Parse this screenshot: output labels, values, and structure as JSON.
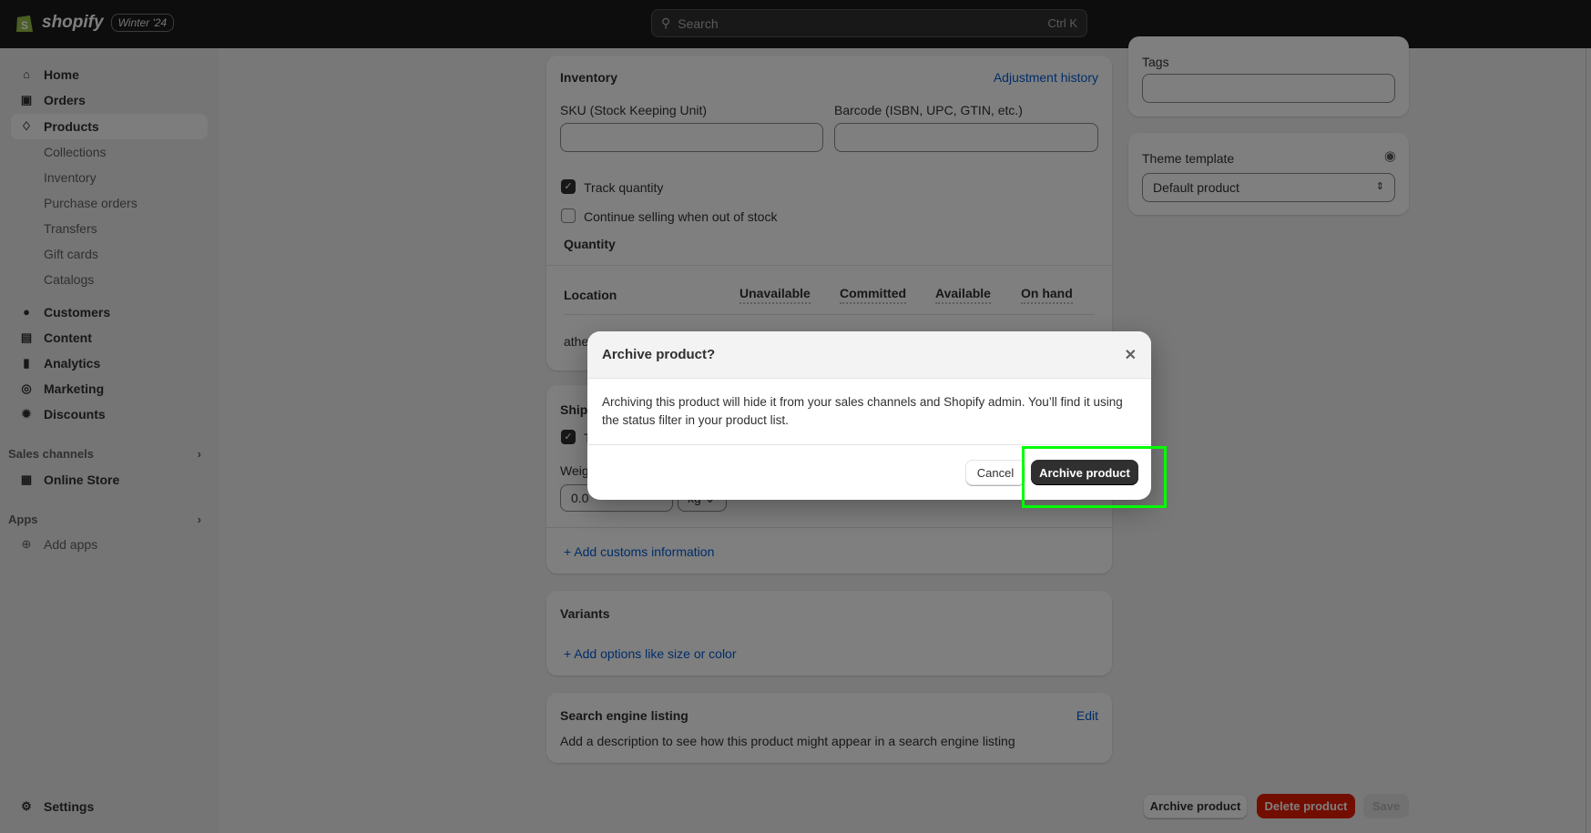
{
  "topbar": {
    "brand": "shopify",
    "badge": "Winter '24",
    "search_placeholder": "Search",
    "search_shortcut": "Ctrl K"
  },
  "sidebar": {
    "items": [
      {
        "label": "Home",
        "icon": "home-icon"
      },
      {
        "label": "Orders",
        "icon": "inbox-icon"
      },
      {
        "label": "Products",
        "icon": "tag-icon",
        "active": true
      }
    ],
    "product_sub": [
      "Collections",
      "Inventory",
      "Purchase orders",
      "Transfers",
      "Gift cards",
      "Catalogs"
    ],
    "items2": [
      {
        "label": "Customers",
        "icon": "person-icon"
      },
      {
        "label": "Content",
        "icon": "content-icon"
      },
      {
        "label": "Analytics",
        "icon": "bar-chart-icon"
      },
      {
        "label": "Marketing",
        "icon": "target-icon"
      },
      {
        "label": "Discounts",
        "icon": "discount-icon"
      }
    ],
    "sales_channels": "Sales channels",
    "online_store": "Online Store",
    "apps": "Apps",
    "add_apps": "Add apps",
    "settings": "Settings"
  },
  "inventory": {
    "title": "Inventory",
    "adjustment_history": "Adjustment history",
    "sku_label": "SKU (Stock Keeping Unit)",
    "barcode_label": "Barcode (ISBN, UPC, GTIN, etc.)",
    "sku_value": "",
    "barcode_value": "",
    "track_quantity": "Track quantity",
    "continue_selling": "Continue selling when out of stock",
    "quantity": "Quantity",
    "columns": [
      "Location",
      "Unavailable",
      "Committed",
      "Available",
      "On hand"
    ],
    "row_location": "athe"
  },
  "shipping": {
    "title": "Shipping",
    "checkbox_label": "T",
    "weight_label": "Weight",
    "weight_value": "0.0",
    "unit": "kg",
    "add_customs": "Add customs information"
  },
  "variants": {
    "title": "Variants",
    "add_options": "Add options like size or color"
  },
  "seo": {
    "title": "Search engine listing",
    "edit": "Edit",
    "description": "Add a description to see how this product might appear in a search engine listing"
  },
  "right": {
    "tags_label": "Tags",
    "tags_value": "",
    "theme_label": "Theme template",
    "theme_value": "Default product"
  },
  "footer": {
    "archive": "Archive product",
    "delete": "Delete product",
    "save": "Save"
  },
  "modal": {
    "title": "Archive product?",
    "body": "Archiving this product will hide it from your sales channels and Shopify admin. You’ll find it using the status filter in your product list.",
    "cancel": "Cancel",
    "confirm": "Archive product"
  },
  "colors": {
    "primary": "#303030",
    "critical": "#c5280c",
    "link": "#005bd3",
    "highlight": "#00ff00"
  }
}
